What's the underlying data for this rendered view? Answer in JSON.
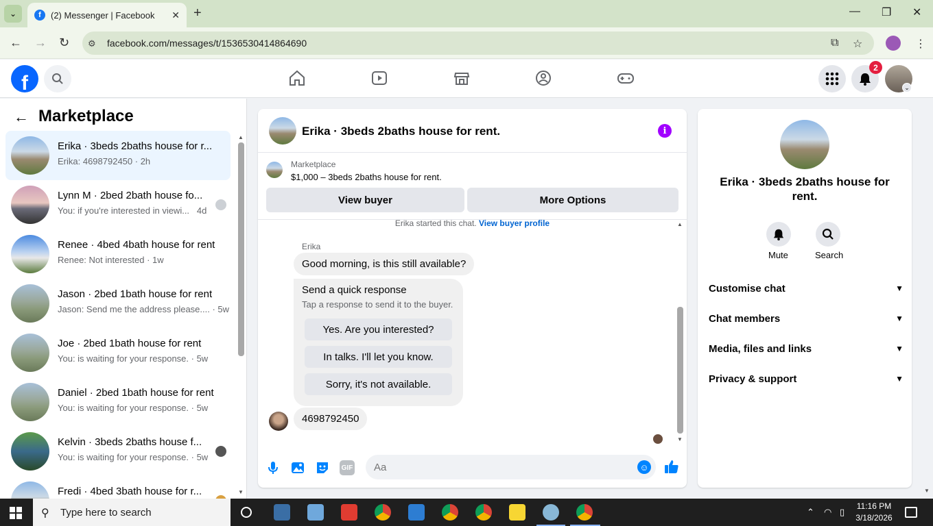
{
  "browser": {
    "tab_title": "(2) Messenger | Facebook",
    "url": "facebook.com/messages/t/1536530414864690"
  },
  "fb": {
    "notification_count": "2"
  },
  "sidebar": {
    "title": "Marketplace",
    "conversations": [
      {
        "name": "Erika · 3beds 2baths house for r...",
        "preview": "Erika: 4698792450 · 2h"
      },
      {
        "name": "Lynn M · 2bed 2bath house fo...",
        "preview": "You: if you're interested in viewi...",
        "time": "4d"
      },
      {
        "name": "Renee · 4bed 4bath house for rent",
        "preview": "Renee: Not interested · 1w"
      },
      {
        "name": "Jason · 2bed 1bath house for rent",
        "preview": "Jason: Send me the address please.... · 5w"
      },
      {
        "name": "Joe · 2bed 1bath house for rent",
        "preview": "You: is waiting for your response. · 5w"
      },
      {
        "name": "Daniel · 2bed 1bath house for rent",
        "preview": "You: is waiting for your response. · 5w"
      },
      {
        "name": "Kelvin · 3beds 2baths house f...",
        "preview": "You: is waiting for your response. · 5w"
      },
      {
        "name": "Fredi · 4bed 3bath house for r...",
        "preview": ""
      }
    ]
  },
  "chat": {
    "title": "Erika · 3beds 2baths house for rent.",
    "marketplace_label": "Marketplace",
    "listing": "$1,000 – 3beds 2baths house for rent.",
    "view_buyer": "View buyer",
    "more_options": "More Options",
    "started_text": "Erika started this chat.",
    "view_buyer_profile": "View buyer profile",
    "sender": "Erika",
    "msg1": "Good morning, is this still available?",
    "quick_title": "Send a quick response",
    "quick_sub": "Tap a response to send it to the buyer.",
    "quick_replies": [
      "Yes. Are you interested?",
      "In talks. I'll let you know.",
      "Sorry, it's not available."
    ],
    "msg2": "4698792450",
    "input_placeholder": "Aa",
    "gif_label": "GIF"
  },
  "details": {
    "name": "Erika · 3beds 2baths house for rent.",
    "mute": "Mute",
    "search": "Search",
    "sections": [
      "Customise chat",
      "Chat members",
      "Media, files and links",
      "Privacy & support"
    ]
  },
  "taskbar": {
    "search_placeholder": "Type here to search",
    "time": "11:16 PM",
    "date": "3/18/2026"
  },
  "colors": {
    "fb_blue": "#0866ff",
    "active_row": "#ebf5ff",
    "messenger_blue": "#0084ff",
    "info_purple": "#a100ff"
  }
}
